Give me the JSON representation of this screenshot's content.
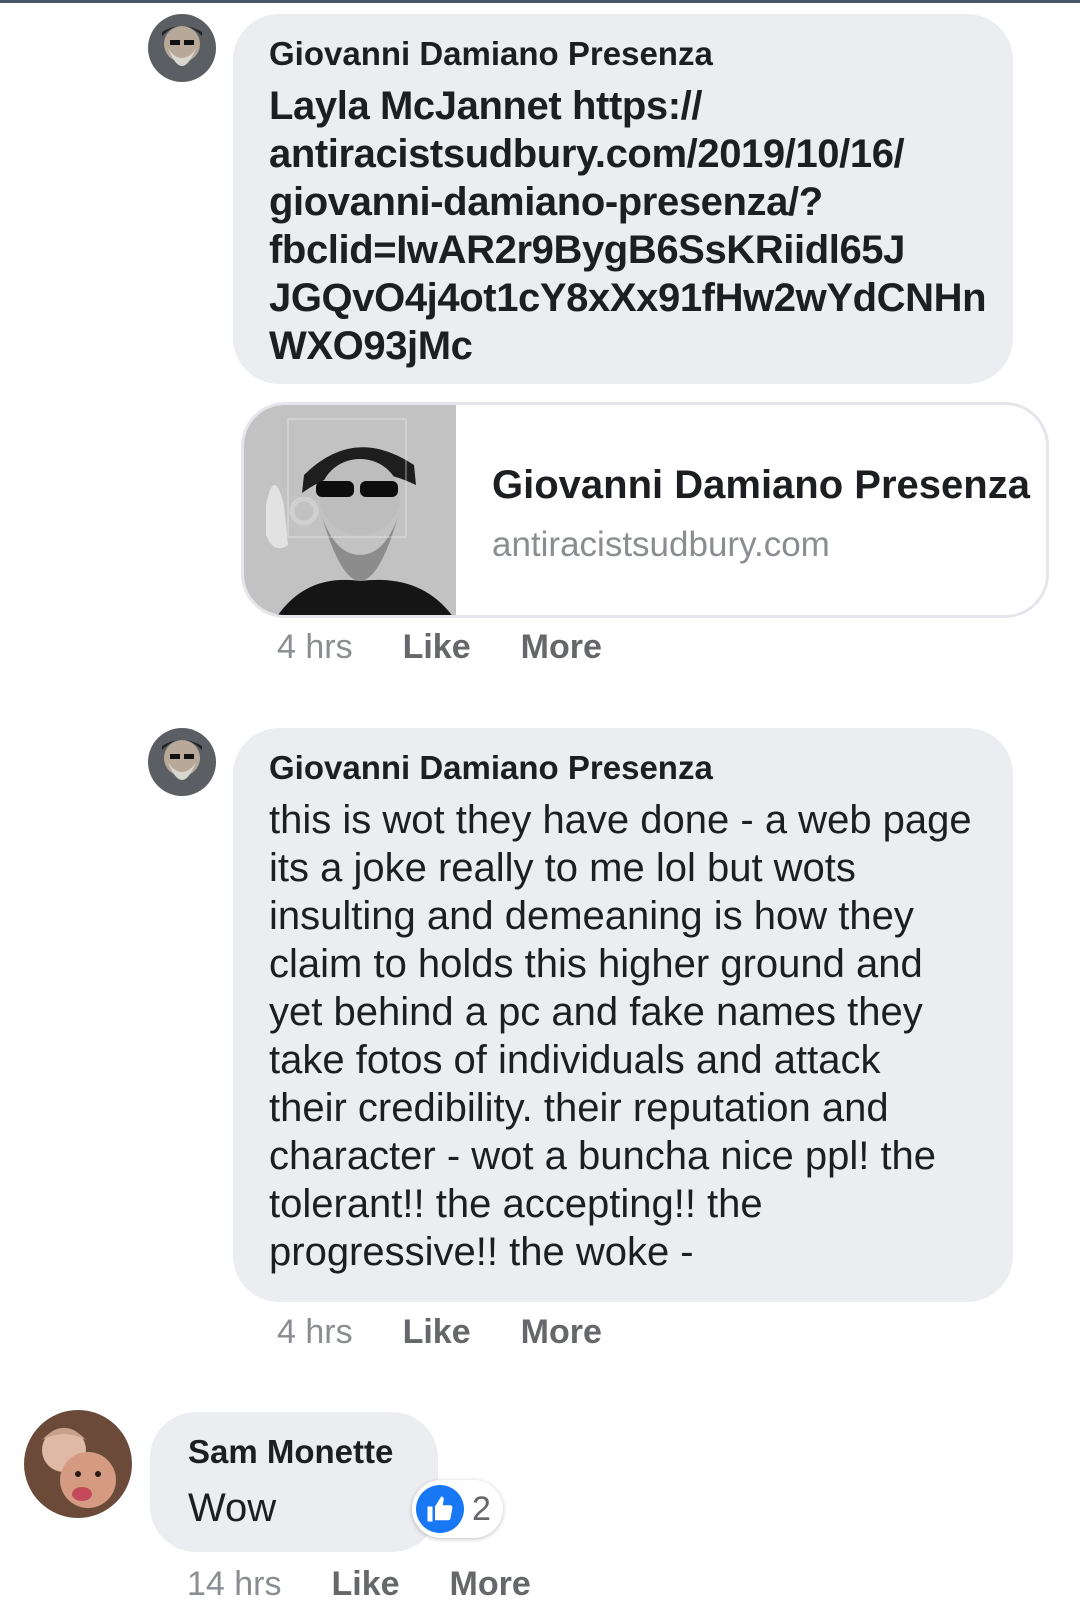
{
  "comments": [
    {
      "author": "Giovanni Damiano Presenza",
      "text": "Layla McJannet https://\nantiracistsudbury.com/2019/10/16/\ngiovanni-damiano-presenza/?\nfbclid=IwAR2r9BygB6SsKRiidl65J\nJGQvO4j4ot1cY8xXx91fHw2wYdCNHn\nWXO93jMc",
      "link_preview": {
        "title": "Giovanni Damiano Presenza",
        "domain": "antiracistsudbury.com"
      },
      "time": "4 hrs",
      "like_label": "Like",
      "more_label": "More"
    },
    {
      "author": "Giovanni Damiano Presenza",
      "text": "this is wot they have done - a web page\nits a joke really to me lol but wots\ninsulting and demeaning is how they\nclaim to holds this higher ground and\nyet behind a pc and fake names they\ntake fotos of individuals and attack\ntheir credibility. their reputation and\ncharacter - wot a buncha nice ppl! the\ntolerant!! the accepting!! the\nprogressive!! the woke -",
      "time": "4 hrs",
      "like_label": "Like",
      "more_label": "More"
    },
    {
      "author": "Sam Monette",
      "text": "Wow",
      "reaction": {
        "icon": "thumbs-up-icon",
        "count": "2"
      },
      "time": "14 hrs",
      "like_label": "Like",
      "more_label": "More"
    }
  ],
  "colors": {
    "bubble": "#ebedf0",
    "meta_text": "#65676b",
    "like_blue": "#1877f2"
  }
}
